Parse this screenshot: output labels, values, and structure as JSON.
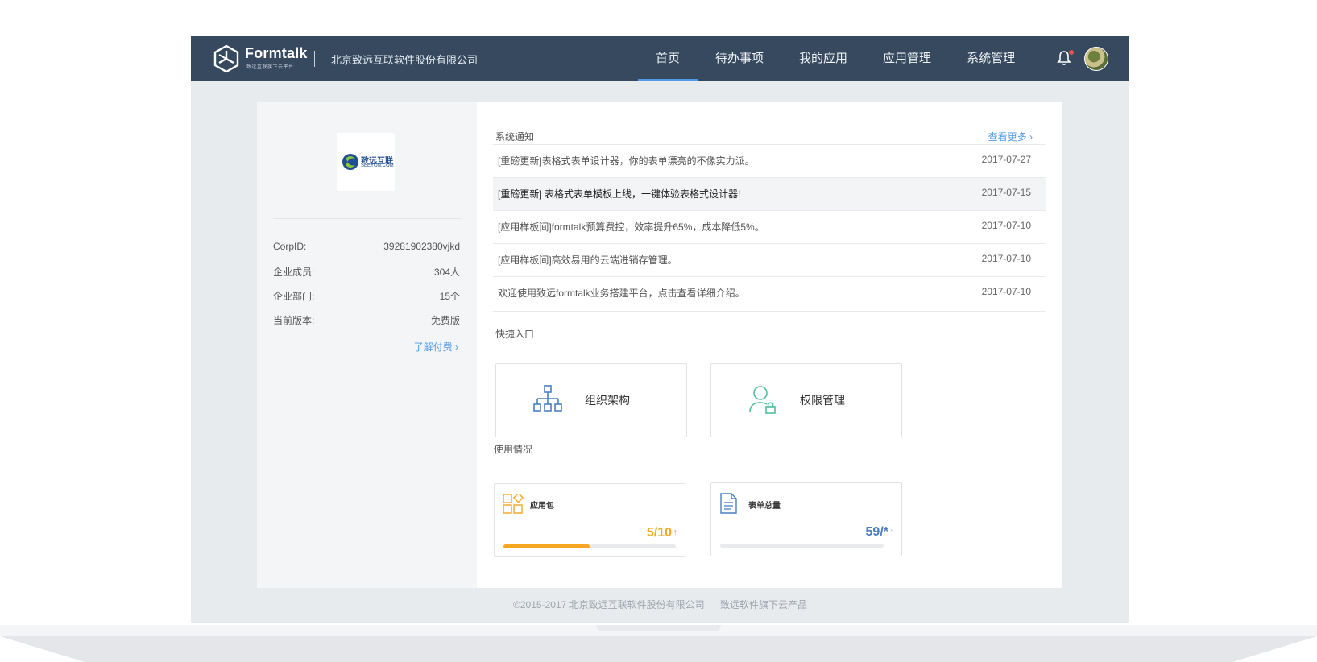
{
  "header": {
    "brand_name": "Formtalk",
    "brand_sub": "致远互联旗下云平台",
    "company": "北京致远互联软件股份有限公司",
    "nav": [
      {
        "label": "首页",
        "active": true
      },
      {
        "label": "待办事项",
        "active": false
      },
      {
        "label": "我的应用",
        "active": false
      },
      {
        "label": "应用管理",
        "active": false
      },
      {
        "label": "系统管理",
        "active": false
      }
    ],
    "has_unread_notification": true
  },
  "sidebar": {
    "logo_text": "致远互联",
    "logo_sub": "SEEYON.COM",
    "info": [
      {
        "key": "CorpID:",
        "value": "39281902380vjkd"
      },
      {
        "key": "企业成员:",
        "value": "304人"
      },
      {
        "key": "企业部门:",
        "value": "15个"
      },
      {
        "key": "当前版本:",
        "value": "免费版"
      }
    ],
    "upgrade_link": "了解付费 ›"
  },
  "notices": {
    "title": "系统通知",
    "more_link": "查看更多 ›",
    "items": [
      {
        "text": "[重磅更新]表格式表单设计器，你的表单漂亮的不像实力派。",
        "date": "2017-07-27",
        "highlight": false
      },
      {
        "text": "[重磅更新] 表格式表单模板上线，一键体验表格式设计器!",
        "date": "2017-07-15",
        "highlight": true
      },
      {
        "text": "[应用样板间]formtalk预算费控，效率提升65%，成本降低5%。",
        "date": "2017-07-10",
        "highlight": false
      },
      {
        "text": "[应用样板间]高效易用的云端进销存管理。",
        "date": "2017-07-10",
        "highlight": false
      },
      {
        "text": "欢迎使用致远formtalk业务搭建平台，点击查看详细介绍。",
        "date": "2017-07-10",
        "highlight": false
      }
    ]
  },
  "quick_entry": {
    "title": "快捷入口",
    "items": [
      {
        "label": "组织架构",
        "icon": "org-chart-icon"
      },
      {
        "label": "权限管理",
        "icon": "user-lock-icon"
      }
    ]
  },
  "usage": {
    "title": "使用情况",
    "items": [
      {
        "label": "应用包",
        "value": "5/10",
        "arrow": "↑",
        "fraction": 0.5,
        "color": "#f5a623",
        "icon": "app-package-icon"
      },
      {
        "label": "表单总量",
        "value": "59/*",
        "arrow": "↑",
        "fraction": 0,
        "color": "#4a7fc1",
        "icon": "form-document-icon"
      }
    ]
  },
  "footer": {
    "copyright": "©2015-2017 北京致远互联软件股份有限公司",
    "tagline": "致远软件旗下云产品"
  },
  "colors": {
    "topbar": "#36495f",
    "accent": "#4e9ae8",
    "highlight_row": "#f3f4f6",
    "page_bg": "#e8ebee"
  }
}
